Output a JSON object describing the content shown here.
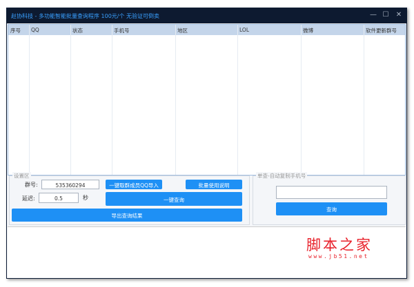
{
  "window": {
    "title": "赵协科技 - 多功能智能批量查询程序  100元/个 无验证可倒卖",
    "minimize": "—",
    "maximize": "☐",
    "close": "✕"
  },
  "table": {
    "columns": [
      "序号",
      "QQ",
      "状态",
      "手机号",
      "地区",
      "LOL",
      "微博",
      "软件更新群号"
    ],
    "rows": []
  },
  "settings": {
    "legend": "设置区",
    "group_label": "群号:",
    "group_value": "535360294",
    "delay_label": "延迟:",
    "delay_value": "0.5",
    "delay_unit": "秒",
    "import_button": "一键取群成员QQ导入",
    "help_button": "批量使用说明",
    "query_all_button": "一键查询",
    "export_button": "导出查询结果"
  },
  "single": {
    "legend": "单查-自动复制手机号",
    "input_value": "",
    "query_button": "查询"
  },
  "watermark": {
    "logo": "脚本之家",
    "url": "www.jb51.net"
  }
}
